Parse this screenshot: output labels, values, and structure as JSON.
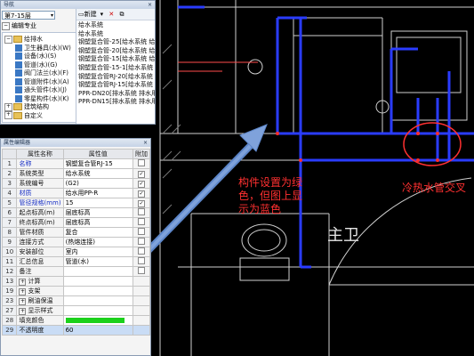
{
  "navigator": {
    "title": "导航",
    "floor": "第7-15层",
    "tab_label": "编辑专业",
    "tree": [
      {
        "toggle": "−",
        "kind": "folder",
        "label": "给排水"
      },
      {
        "toggle": "",
        "kind": "icon",
        "label": "卫生器具(水)(W)"
      },
      {
        "toggle": "",
        "kind": "icon",
        "label": "设备(水)(S)"
      },
      {
        "toggle": "",
        "kind": "icon",
        "label": "管道(水)(G)"
      },
      {
        "toggle": "",
        "kind": "icon",
        "label": "阀门法兰(水)(F)"
      },
      {
        "toggle": "",
        "kind": "icon",
        "label": "管道附件(水)(A)"
      },
      {
        "toggle": "",
        "kind": "icon",
        "label": "通头管件(水)(J)"
      },
      {
        "toggle": "",
        "kind": "icon",
        "label": "零星构件(水)(K)"
      },
      {
        "toggle": "+",
        "kind": "folder",
        "label": "建筑结构"
      },
      {
        "toggle": "+",
        "kind": "folder",
        "label": "自定义"
      }
    ]
  },
  "component_list": {
    "toolbar": {
      "new": "新建",
      "delete": "✕",
      "copy": "⧉"
    },
    "items": [
      "给水系统",
      "给水系统",
      "钢塑复合管-25[给水系统 给",
      "钢塑复合管-20[给水系统 给",
      "钢塑复合管-15[给水系统 给",
      "钢塑复合管-15-1[给水系统",
      "钢塑复合管RJ-20[给水系统",
      "钢塑复合管RJ-15[给水系统",
      "PPR-DN20[排水系统 排水用",
      "PPR-DN15[排水系统 排水用"
    ]
  },
  "properties": {
    "title": "属性编辑器",
    "headers": {
      "name": "属性名称",
      "value": "属性值",
      "extra": "附加"
    },
    "rows": [
      {
        "no": "1",
        "name": "名称",
        "value": "钢塑复合管RJ-15",
        "check": "",
        "blue": true
      },
      {
        "no": "2",
        "name": "系统类型",
        "value": "给水系统",
        "check": "✓",
        "blue": false
      },
      {
        "no": "3",
        "name": "系统编号",
        "value": "(G2)",
        "check": "✓",
        "blue": false
      },
      {
        "no": "4",
        "name": "材质",
        "value": "给水用PP-R",
        "check": "✓",
        "blue": true
      },
      {
        "no": "5",
        "name": "管径规格(mm)",
        "value": "15",
        "check": "✓",
        "blue": true
      },
      {
        "no": "6",
        "name": "起点标高(m)",
        "value": "层底标高",
        "check": "",
        "blue": false
      },
      {
        "no": "7",
        "name": "终点标高(m)",
        "value": "层底标高",
        "check": "",
        "blue": false
      },
      {
        "no": "8",
        "name": "管件材质",
        "value": "复合",
        "check": "",
        "blue": false
      },
      {
        "no": "9",
        "name": "连接方式",
        "value": "(热熔连接)",
        "check": "",
        "blue": false
      },
      {
        "no": "10",
        "name": "安装部位",
        "value": "室内",
        "check": "",
        "blue": false
      },
      {
        "no": "11",
        "name": "汇总信息",
        "value": "管道(水)",
        "check": "",
        "blue": false
      },
      {
        "no": "12",
        "name": "备注",
        "value": "",
        "check": "",
        "blue": false
      },
      {
        "no": "13",
        "name": "计算",
        "value": "",
        "check": "",
        "blue": false,
        "group": true
      },
      {
        "no": "19",
        "name": "支架",
        "value": "",
        "check": "",
        "blue": false,
        "group": true
      },
      {
        "no": "23",
        "name": "刷油保温",
        "value": "",
        "check": "",
        "blue": false,
        "group": true
      },
      {
        "no": "27",
        "name": "显示样式",
        "value": "",
        "check": "",
        "blue": false,
        "group": true
      },
      {
        "no": "28",
        "name": "填充颜色",
        "value": "",
        "check": "",
        "blue": false,
        "fill": true
      },
      {
        "no": "29",
        "name": "不透明度",
        "value": "60",
        "check": "",
        "blue": false,
        "selected": true
      }
    ]
  },
  "annotations": {
    "left": [
      "构件设置为绿",
      "色，但图上显",
      "示为蓝色"
    ],
    "right": "冷热水管交叉",
    "room": "主卫"
  },
  "colors": {
    "pipe": "#2a3cff",
    "annotation": "#ff3030",
    "fill": "#1bd11b"
  }
}
